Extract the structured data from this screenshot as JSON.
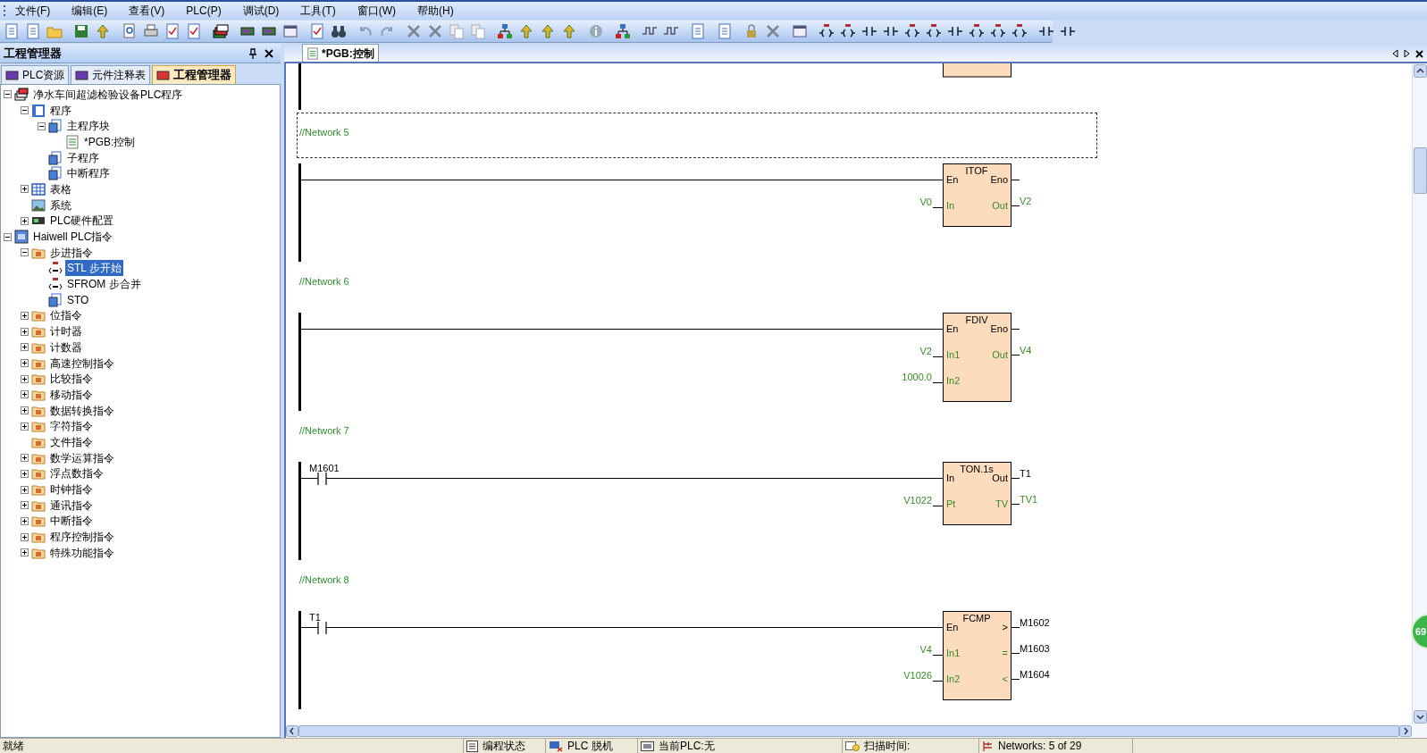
{
  "menu": [
    "文件(F)",
    "编辑(E)",
    "查看(V)",
    "PLC(P)",
    "调试(D)",
    "工具(T)",
    "窗口(W)",
    "帮助(H)"
  ],
  "left_panel": {
    "title": "工程管理器",
    "tabs": [
      {
        "label": "PLC资源",
        "selected": false
      },
      {
        "label": "元件注释表",
        "selected": false
      },
      {
        "label": "工程管理器",
        "selected": true
      }
    ],
    "tree": [
      {
        "label": "净水车间超滤检验设备PLC程序",
        "kind": "project",
        "expanded": true,
        "selected": false,
        "children": [
          {
            "label": "程序",
            "kind": "program",
            "expanded": true,
            "selected": false,
            "children": [
              {
                "label": "主程序块",
                "kind": "block",
                "expanded": true,
                "selected": false,
                "children": [
                  {
                    "label": "*PGB:控制",
                    "kind": "ladder",
                    "selected": false
                  }
                ]
              },
              {
                "label": "子程序",
                "kind": "block",
                "selected": false
              },
              {
                "label": "中断程序",
                "kind": "block",
                "selected": false
              }
            ]
          },
          {
            "label": "表格",
            "kind": "table",
            "expanded": false,
            "selected": false
          },
          {
            "label": "系统",
            "kind": "image",
            "selected": false
          },
          {
            "label": "PLC硬件配置",
            "kind": "hardware",
            "expanded": false,
            "selected": false
          }
        ]
      },
      {
        "label": "Haiwell PLC指令",
        "kind": "library",
        "expanded": true,
        "selected": false,
        "children": [
          {
            "label": "步进指令",
            "kind": "folder",
            "expanded": true,
            "selected": false,
            "children": [
              {
                "label": "STL 步开始",
                "kind": "step",
                "selected": true
              },
              {
                "label": "SFROM 步合并",
                "kind": "step",
                "selected": false
              },
              {
                "label": "STO",
                "kind": "block",
                "selected": false
              }
            ]
          },
          {
            "label": "位指令",
            "kind": "folder",
            "expanded": false,
            "selected": false
          },
          {
            "label": "计时器",
            "kind": "folder",
            "expanded": false,
            "selected": false
          },
          {
            "label": "计数器",
            "kind": "folder",
            "expanded": false,
            "selected": false
          },
          {
            "label": "高速控制指令",
            "kind": "folder",
            "expanded": false,
            "selected": false
          },
          {
            "label": "比较指令",
            "kind": "folder",
            "expanded": false,
            "selected": false
          },
          {
            "label": "移动指令",
            "kind": "folder",
            "expanded": false,
            "selected": false
          },
          {
            "label": "数据转换指令",
            "kind": "folder",
            "expanded": false,
            "selected": false
          },
          {
            "label": "字符指令",
            "kind": "folder",
            "expanded": false,
            "selected": false
          },
          {
            "label": "文件指令",
            "kind": "folder",
            "selected": false
          },
          {
            "label": "数学运算指令",
            "kind": "folder",
            "expanded": false,
            "selected": false
          },
          {
            "label": "浮点数指令",
            "kind": "folder",
            "expanded": false,
            "selected": false
          },
          {
            "label": "时钟指令",
            "kind": "folder",
            "expanded": false,
            "selected": false
          },
          {
            "label": "通讯指令",
            "kind": "folder",
            "expanded": false,
            "selected": false
          },
          {
            "label": "中断指令",
            "kind": "folder",
            "expanded": false,
            "selected": false
          },
          {
            "label": "程序控制指令",
            "kind": "folder",
            "expanded": false,
            "selected": false
          },
          {
            "label": "特殊功能指令",
            "kind": "folder",
            "expanded": false,
            "selected": false
          }
        ]
      }
    ]
  },
  "editor": {
    "tabs": [
      {
        "label": "*PGB:控制",
        "selected": true
      }
    ],
    "networks": [
      {
        "comment": "//Network 5",
        "selected": true,
        "block": {
          "title": "ITOF",
          "rows": [
            {
              "kind": "flow",
              "left_pin": "En",
              "right_pin": "Eno"
            },
            {
              "kind": "data",
              "left_pin": "In",
              "left_operand": {
                "text": "V0",
                "kind": "word"
              },
              "right_pin": "Out",
              "right_operand": {
                "text": "V2",
                "kind": "word"
              }
            }
          ]
        }
      },
      {
        "comment": "//Network 6",
        "selected": false,
        "block": {
          "title": "FDIV",
          "rows": [
            {
              "kind": "flow",
              "left_pin": "En",
              "right_pin": "Eno"
            },
            {
              "kind": "data",
              "left_pin": "In1",
              "left_operand": {
                "text": "V2",
                "kind": "word"
              },
              "right_pin": "Out",
              "right_operand": {
                "text": "V4",
                "kind": "word"
              }
            },
            {
              "kind": "data",
              "left_pin": "In2",
              "left_operand": {
                "text": "1000.0",
                "kind": "word"
              }
            }
          ]
        }
      },
      {
        "comment": "//Network 7",
        "selected": false,
        "contact": "M1601",
        "block": {
          "title": "TON.1s",
          "rows": [
            {
              "kind": "flow",
              "left_pin": "In",
              "right_pin": "Out",
              "right_operand": {
                "text": "T1",
                "kind": "bit"
              }
            },
            {
              "kind": "data",
              "left_pin": "Pt",
              "left_operand": {
                "text": "V1022",
                "kind": "word"
              },
              "right_pin": "TV",
              "right_operand": {
                "text": "TV1",
                "kind": "word"
              }
            }
          ]
        }
      },
      {
        "comment": "//Network 8",
        "selected": false,
        "contact": "T1",
        "block": {
          "title": "FCMP",
          "rows": [
            {
              "kind": "flow",
              "left_pin": "En",
              "right_pin": ">",
              "right_operand": {
                "text": "M1602",
                "kind": "bit"
              }
            },
            {
              "kind": "data",
              "left_pin": "In1",
              "left_operand": {
                "text": "V4",
                "kind": "word"
              },
              "right_pin": "=",
              "right_operand": {
                "text": "M1603",
                "kind": "bit"
              }
            },
            {
              "kind": "data",
              "left_pin": "In2",
              "left_operand": {
                "text": "V1026",
                "kind": "word"
              },
              "right_pin": "<",
              "right_operand": {
                "text": "M1604",
                "kind": "bit"
              }
            }
          ]
        }
      }
    ]
  },
  "floating_badge": "69",
  "status_bar": {
    "message": "就绪",
    "mode": "编程状态",
    "connection": "PLC 脱机",
    "current_plc": "当前PLC:无",
    "scan_time": "扫描时间:",
    "networks": "Networks:  5 of 29"
  }
}
